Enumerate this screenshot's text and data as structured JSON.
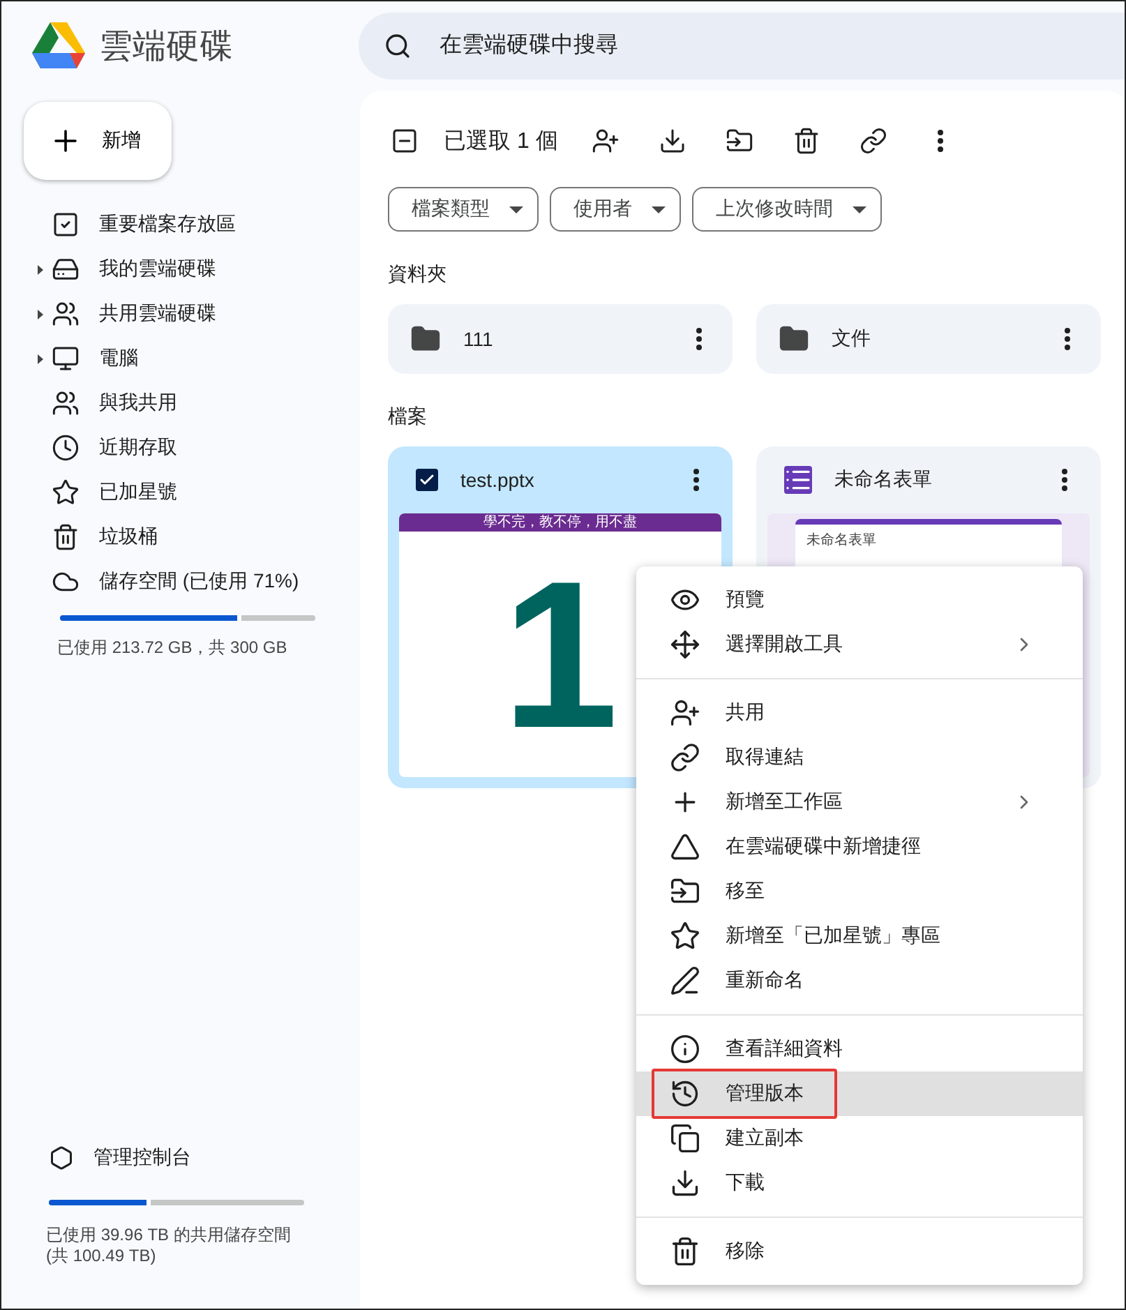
{
  "app": {
    "title": "雲端硬碟"
  },
  "search": {
    "placeholder": "在雲端硬碟中搜尋"
  },
  "new_button": {
    "label": "新增"
  },
  "sidebar": {
    "items": [
      {
        "label": "重要檔案存放區",
        "expandable": false
      },
      {
        "label": "我的雲端硬碟",
        "expandable": true
      },
      {
        "label": "共用雲端硬碟",
        "expandable": true
      },
      {
        "label": "電腦",
        "expandable": true
      },
      {
        "label": "與我共用",
        "expandable": false
      },
      {
        "label": "近期存取",
        "expandable": false
      },
      {
        "label": "已加星號",
        "expandable": false
      },
      {
        "label": "垃圾桶",
        "expandable": false
      },
      {
        "label": "儲存空間 (已使用 71%)",
        "expandable": false
      }
    ],
    "storage": {
      "level": 0.71,
      "text": "已使用 213.72 GB，共 300 GB"
    },
    "admin": {
      "label": "管理控制台",
      "level": 0.4,
      "text": "已使用 39.96 TB 的共用儲存空間\n(共 100.49 TB)"
    }
  },
  "toolbar": {
    "selection": "已選取 1 個"
  },
  "filters": [
    "檔案類型",
    "使用者",
    "上次修改時間"
  ],
  "folders_heading": "資料夾",
  "folders": [
    {
      "name": "111",
      "selected": false
    },
    {
      "name": "文件",
      "selected": false
    }
  ],
  "files_heading": "檔案",
  "files": [
    {
      "name": "test.pptx",
      "kind": "slides",
      "selected": true,
      "thumbnail": {
        "banner": "學不完，教不停，用不盡",
        "big": "1"
      }
    },
    {
      "name": "未命名表單",
      "kind": "form",
      "selected": false,
      "thumbnail": {
        "banner": "未命名表單"
      }
    }
  ],
  "context_menu": {
    "sections": [
      {
        "items": [
          {
            "label": "預覽",
            "submenu": false,
            "highlighted": false
          },
          {
            "label": "選擇開啟工具",
            "submenu": true,
            "highlighted": false
          }
        ]
      },
      {
        "items": [
          {
            "label": "共用",
            "submenu": false,
            "highlighted": false
          },
          {
            "label": "取得連結",
            "submenu": false,
            "highlighted": false
          },
          {
            "label": "新增至工作區",
            "submenu": true,
            "highlighted": false
          },
          {
            "label": "在雲端硬碟中新增捷徑",
            "submenu": false,
            "highlighted": false
          },
          {
            "label": "移至",
            "submenu": false,
            "highlighted": false
          },
          {
            "label": "新增至「已加星號」專區",
            "submenu": false,
            "highlighted": false
          },
          {
            "label": "重新命名",
            "submenu": false,
            "highlighted": false
          }
        ]
      },
      {
        "items": [
          {
            "label": "查看詳細資料",
            "submenu": false,
            "highlighted": false
          },
          {
            "label": "管理版本",
            "submenu": false,
            "highlighted": true
          },
          {
            "label": "建立副本",
            "submenu": false,
            "highlighted": false
          },
          {
            "label": "下載",
            "submenu": false,
            "highlighted": false
          }
        ]
      },
      {
        "items": [
          {
            "label": "移除",
            "submenu": false,
            "highlighted": false
          }
        ]
      }
    ]
  }
}
